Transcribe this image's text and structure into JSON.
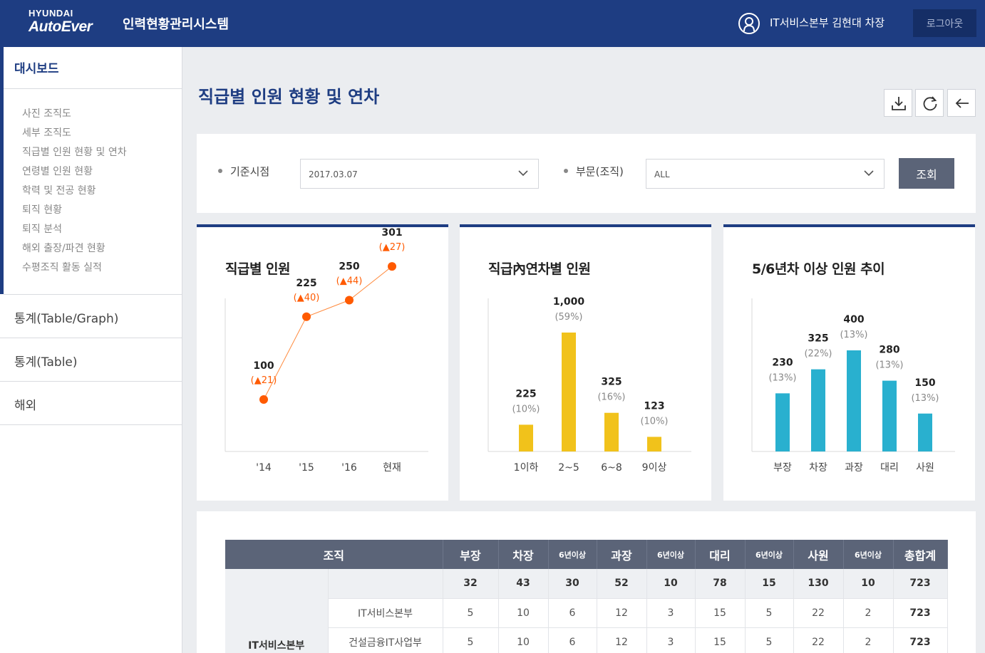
{
  "header": {
    "logo_top": "HYUNDAI",
    "logo_bottom": "AutoEver",
    "app_title": "인력현황관리시스템",
    "user": "IT서비스본부 김현대 차장",
    "logout": "로그아웃"
  },
  "sidebar": {
    "dashboard": "대시보드",
    "sub_items": [
      "사진 조직도",
      "세부 조직도",
      "직급별 인원 현황 및 연차",
      "연령별 인원 현황",
      "학력 및 전공 현황",
      "퇴직 현황",
      "퇴직 분석",
      "해외 출장/파견 현황",
      "수평조직 활동 실적"
    ],
    "menus": [
      "통계(Table/Graph)",
      "통계(Table)",
      "해외"
    ]
  },
  "page_title": "직급별 인원 현황 및 연차",
  "toolbar": {
    "icons": [
      "download-icon",
      "refresh-icon",
      "back-arrow-icon"
    ]
  },
  "filter": {
    "date_label": "기준시점",
    "date_value": "2017.03.07",
    "org_label": "부문(조직)",
    "org_value": "ALL",
    "search": "조회"
  },
  "colors": {
    "navy": "#1e3d82",
    "orange": "#ff5a00",
    "yellow": "#f1c21b",
    "cyan": "#29b0cf"
  },
  "chart_data": [
    {
      "type": "line",
      "title": "직급별 인원",
      "categories": [
        "'14",
        "'15",
        "'16",
        "현재"
      ],
      "values": [
        100,
        225,
        250,
        301
      ],
      "annotations": [
        "(▲21)",
        "(▲40)",
        "(▲44)",
        "(▲27)"
      ]
    },
    {
      "type": "bar",
      "title": "직급內연차별 인원",
      "categories": [
        "1이하",
        "2~5",
        "6~8",
        "9이상"
      ],
      "values": [
        225,
        1000,
        325,
        123
      ],
      "value_labels": [
        "225",
        "1,000",
        "325",
        "123"
      ],
      "percents": [
        "(10%)",
        "(59%)",
        "(16%)",
        "(10%)"
      ]
    },
    {
      "type": "bar",
      "title": "5/6년차 이상 인원 추이",
      "categories": [
        "부장",
        "차장",
        "과장",
        "대리",
        "사원"
      ],
      "values": [
        230,
        325,
        400,
        280,
        150
      ],
      "value_labels": [
        "230",
        "325",
        "400",
        "280",
        "150"
      ],
      "percents": [
        "(13%)",
        "(22%)",
        "(13%)",
        "(13%)",
        "(13%)"
      ]
    }
  ],
  "table": {
    "headers": [
      "조직",
      "부장",
      "차장",
      "6년이상",
      "과장",
      "6년이상",
      "대리",
      "6년이상",
      "사원",
      "6년이상",
      "총합계"
    ],
    "total_row": [
      "32",
      "43",
      "30",
      "52",
      "10",
      "78",
      "15",
      "130",
      "10",
      "723"
    ],
    "org": "IT서비스본부",
    "rows": [
      {
        "name": "IT서비스본부",
        "values": [
          "5",
          "10",
          "6",
          "12",
          "3",
          "15",
          "5",
          "22",
          "2",
          "723"
        ]
      },
      {
        "name": "건설금융IT사업부",
        "values": [
          "5",
          "10",
          "6",
          "12",
          "3",
          "15",
          "5",
          "22",
          "2",
          "723"
        ]
      }
    ]
  }
}
